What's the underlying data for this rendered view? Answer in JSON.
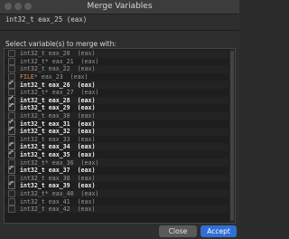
{
  "window": {
    "title": "Merge Variables"
  },
  "header": {
    "variable": "int32_t eax_25  (eax)"
  },
  "prompt": "Select variable(s) to merge with:",
  "rows": [
    {
      "type": "int32_t",
      "sep": " ",
      "name": "eax_20",
      "reg": "(eax)",
      "checked": false,
      "type_color": ""
    },
    {
      "type": "int32_t",
      "sep": "* ",
      "name": "eax_21",
      "reg": "(eax)",
      "checked": false,
      "type_color": ""
    },
    {
      "type": "int32_t",
      "sep": " ",
      "name": "eax_22",
      "reg": "(eax)",
      "checked": false,
      "type_color": ""
    },
    {
      "type": "FILE",
      "sep": "* ",
      "name": "eax_23",
      "reg": "(eax)",
      "checked": false,
      "type_color": "#e8935a"
    },
    {
      "type": "int32_t",
      "sep": " ",
      "name": "eax_26",
      "reg": "(eax)",
      "checked": true,
      "type_color": ""
    },
    {
      "type": "int32_t",
      "sep": "* ",
      "name": "eax_27",
      "reg": "(eax)",
      "checked": false,
      "type_color": ""
    },
    {
      "type": "int32_t",
      "sep": " ",
      "name": "eax_28",
      "reg": "(eax)",
      "checked": true,
      "type_color": ""
    },
    {
      "type": "int32_t",
      "sep": " ",
      "name": "eax_29",
      "reg": "(eax)",
      "checked": true,
      "type_color": ""
    },
    {
      "type": "int32_t",
      "sep": " ",
      "name": "eax_30",
      "reg": "(eax)",
      "checked": false,
      "type_color": ""
    },
    {
      "type": "int32_t",
      "sep": " ",
      "name": "eax_31",
      "reg": "(eax)",
      "checked": true,
      "type_color": ""
    },
    {
      "type": "int32_t",
      "sep": " ",
      "name": "eax_32",
      "reg": "(eax)",
      "checked": true,
      "type_color": ""
    },
    {
      "type": "int32_t",
      "sep": " ",
      "name": "eax_33",
      "reg": "(eax)",
      "checked": false,
      "type_color": ""
    },
    {
      "type": "int32_t",
      "sep": " ",
      "name": "eax_34",
      "reg": "(eax)",
      "checked": true,
      "type_color": ""
    },
    {
      "type": "int32_t",
      "sep": " ",
      "name": "eax_35",
      "reg": "(eax)",
      "checked": true,
      "type_color": ""
    },
    {
      "type": "int32_t",
      "sep": "* ",
      "name": "eax_36",
      "reg": "(eax)",
      "checked": false,
      "type_color": ""
    },
    {
      "type": "int32_t",
      "sep": " ",
      "name": "eax_37",
      "reg": "(eax)",
      "checked": true,
      "type_color": ""
    },
    {
      "type": "int32_t",
      "sep": " ",
      "name": "eax_38",
      "reg": "(eax)",
      "checked": false,
      "type_color": ""
    },
    {
      "type": "int32_t",
      "sep": " ",
      "name": "eax_39",
      "reg": "(eax)",
      "checked": true,
      "type_color": ""
    },
    {
      "type": "int32_t",
      "sep": "* ",
      "name": "eax_40",
      "reg": "(eax)",
      "checked": false,
      "type_color": ""
    },
    {
      "type": "int32_t",
      "sep": " ",
      "name": "eax_41",
      "reg": "(eax)",
      "checked": false,
      "type_color": ""
    },
    {
      "type": "int32_t",
      "sep": " ",
      "name": "eax_42",
      "reg": "(eax)",
      "checked": false,
      "type_color": ""
    }
  ],
  "buttons": {
    "close": "Close",
    "accept": "Accept"
  },
  "colors": {
    "accent": "#2f6fd6",
    "file_type": "#e8935a"
  }
}
